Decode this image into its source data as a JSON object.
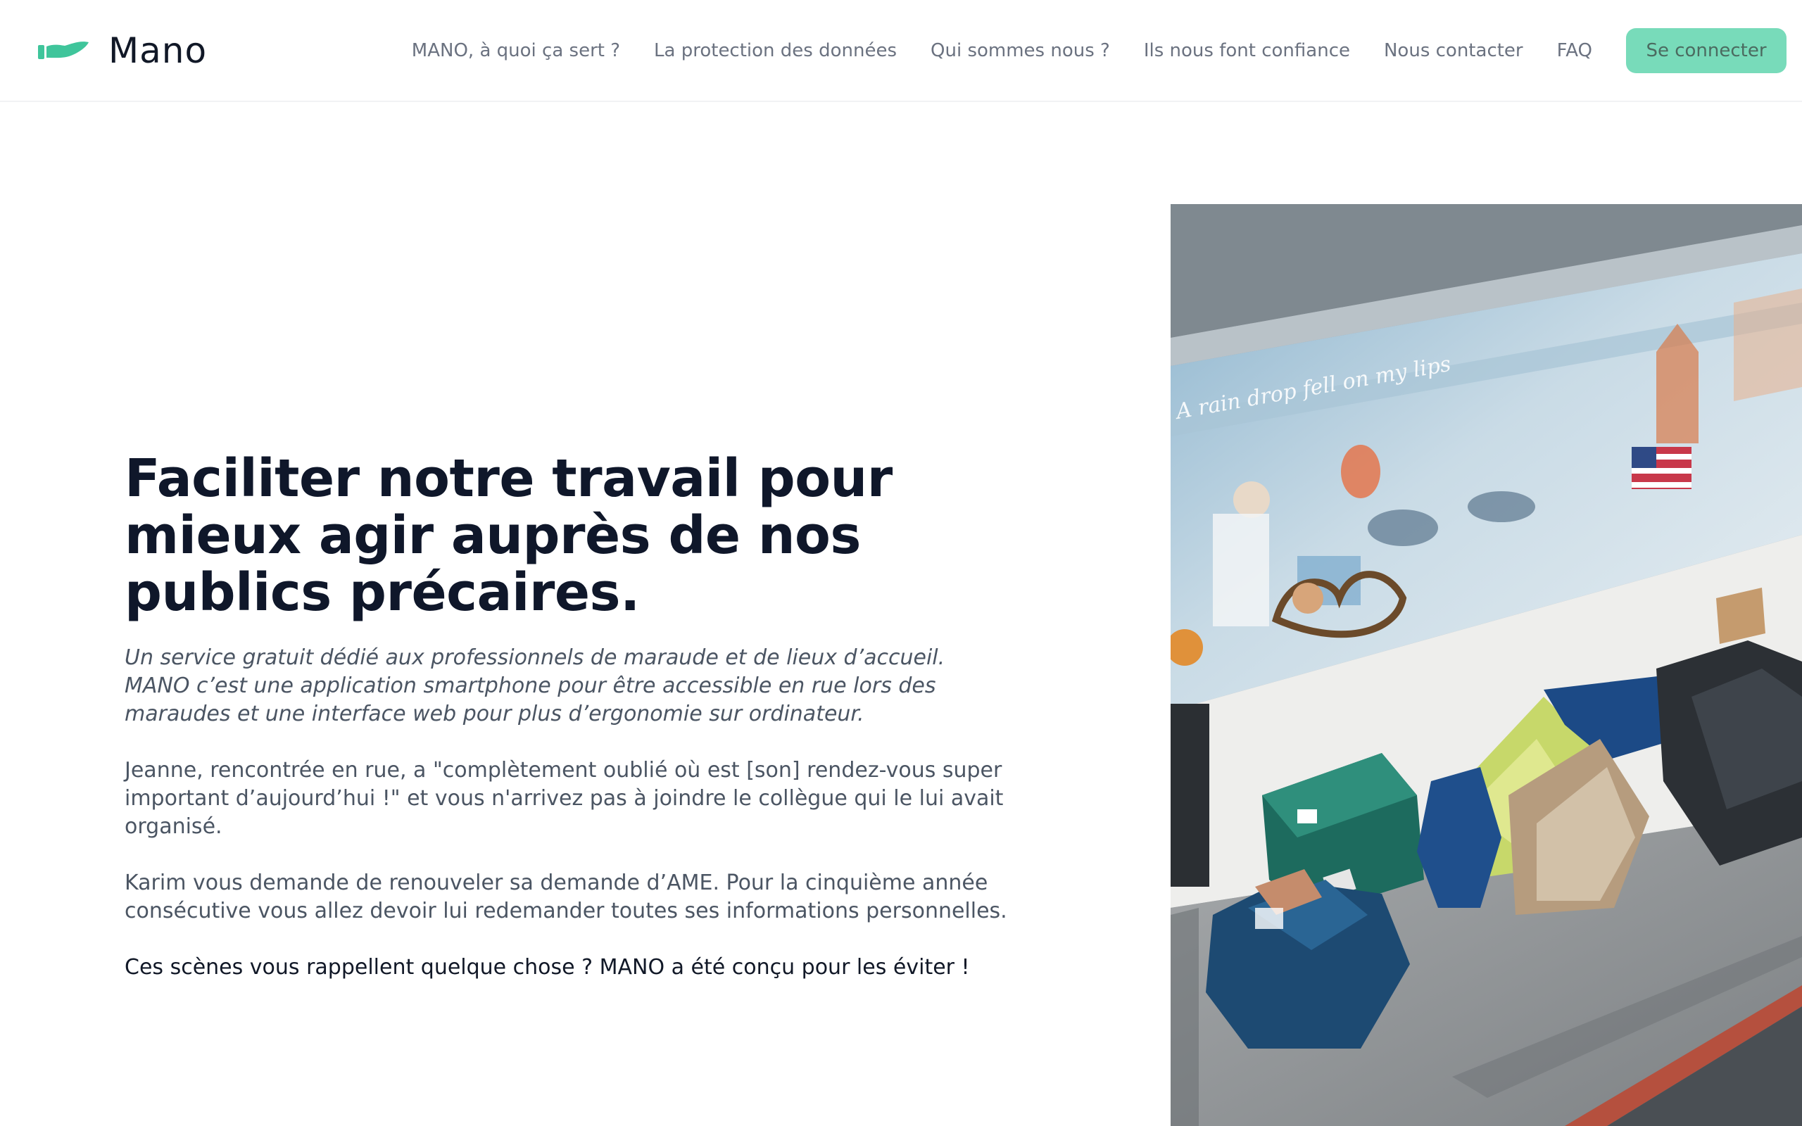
{
  "header": {
    "logo_text": "Mano",
    "nav": [
      "MANO, à quoi ça sert ?",
      "La protection des données",
      "Qui sommes nous ?",
      "Ils nous font confiance",
      "Nous contacter",
      "FAQ"
    ],
    "login_label": "Se connecter"
  },
  "hero": {
    "title": "Faciliter notre travail pour mieux agir auprès de nos publics précaires.",
    "intro_line1": "Un service gratuit dédié aux professionnels de maraude et de lieux d’accueil.",
    "intro_line2": "MANO c’est une application smartphone pour être accessible en rue lors des maraudes et une interface web pour plus d’ergonomie sur ordinateur.",
    "paragraph1": "Jeanne, rencontrée en rue, a \"complètement oublié où est [son] rendez-vous super important d’aujourd’hui !\" et vous n'arrivez pas à joindre le collègue qui le lui avait organisé.",
    "paragraph2": "Karim vous demande de renouveler sa demande d’AME. Pour la cinquième année consécutive vous allez devoir lui redemander toutes ses informations personnelles.",
    "cta": "Ces scènes vous rappellent quelque chose ? MANO a été conçu pour les éviter !"
  },
  "photo": {
    "mural_text": "A rain drop fell on my lips"
  },
  "colors": {
    "accent": "#78dbba",
    "logo_green": "#3fc59b",
    "heading": "#0f172a",
    "body_text": "#4b5563",
    "nav_text": "#6b7280"
  }
}
